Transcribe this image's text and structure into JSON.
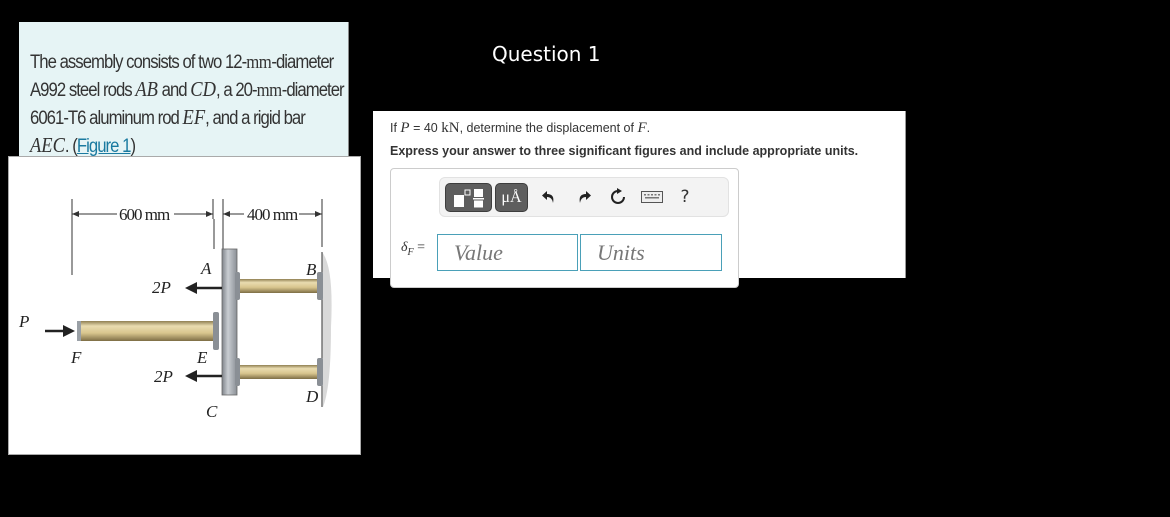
{
  "statement": {
    "text_parts": {
      "p1": "The assembly consists of two 12-",
      "p1_unit": "mm",
      "p2": "-diameter A992 steel rods ",
      "rod1": "AB",
      "p3": " and ",
      "rod2": "CD",
      "p4": ", a 20-",
      "p4_unit": "mm",
      "p5": "-diameter 6061-T6 aluminum rod ",
      "rod3": "EF",
      "p6": ", and a rigid bar ",
      "bar": "AEC",
      "p7": ". (",
      "figure_link": "Figure 1",
      "p8": ")"
    }
  },
  "figure": {
    "dim_left": "600 mm",
    "dim_right": "400 mm",
    "labels": {
      "A": "A",
      "B": "B",
      "C": "C",
      "D": "D",
      "E": "E",
      "F": "F",
      "P": "P",
      "load_top": "2P",
      "load_bottom": "2P"
    },
    "colors": {
      "rod": "#d8c58e",
      "bar": "#a8adb3",
      "wall": "#cfcfcf"
    }
  },
  "question": {
    "title": "Question 1",
    "prompt": {
      "pre": "If ",
      "var": "P",
      "eq": " = 40 ",
      "unit": "kN",
      "mid": ", determine the displacement of ",
      "target": "F",
      "end": "."
    },
    "instruction": "Express your answer to three significant figures and include appropriate units."
  },
  "toolbar": {
    "templates_icon": "templates-icon",
    "units_label": "μÅ",
    "undo_icon": "undo-icon",
    "redo_icon": "redo-icon",
    "reset_icon": "reset-icon",
    "keyboard_icon": "keyboard-icon",
    "help_label": "?"
  },
  "answer": {
    "label_symbol": "δ",
    "label_sub": "F",
    "label_eq": " =",
    "value_placeholder": "Value",
    "units_placeholder": "Units"
  },
  "colors": {
    "field_border": "#4aa0b8",
    "statement_bg": "#e6f4f5",
    "link": "#1a7aa0"
  }
}
